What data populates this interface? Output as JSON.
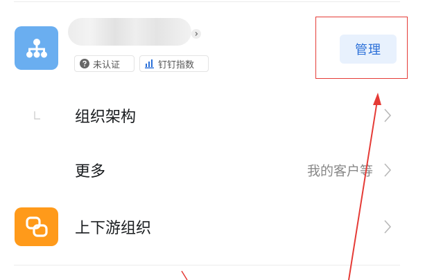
{
  "org": {
    "status_tags": [
      {
        "icon": "question-circle-icon",
        "label": "未认证"
      },
      {
        "icon": "bar-chart-icon",
        "label": "钉钉指数"
      }
    ],
    "manage_label": "管理"
  },
  "menu": {
    "items": [
      {
        "label": "组织架构",
        "value": ""
      },
      {
        "label": "更多",
        "value": "我的客户等"
      },
      {
        "label": "上下游组织",
        "value": ""
      }
    ]
  },
  "colors": {
    "org_icon_bg": "#6aaef0",
    "updown_icon_bg": "#ff9a1a",
    "manage_button_bg": "#e8f1fd",
    "manage_button_text": "#2a6fd8",
    "annotation_red": "#e53a35"
  }
}
